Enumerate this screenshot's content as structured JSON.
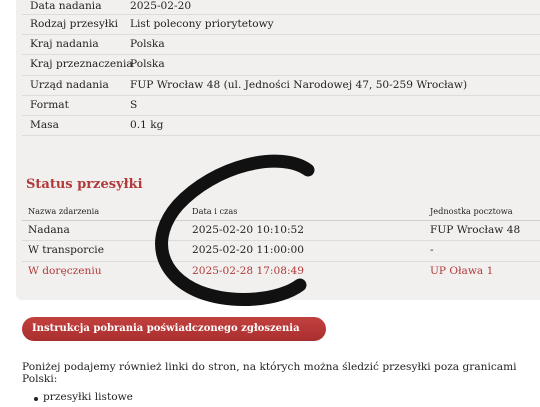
{
  "details": [
    {
      "label": "Data nadania",
      "value": "2025-02-20"
    },
    {
      "label": "Rodzaj przesyłki",
      "value": "List polecony priorytetowy"
    },
    {
      "label": "Kraj nadania",
      "value": "Polska"
    },
    {
      "label": "Kraj przeznaczenia",
      "value": "Polska"
    },
    {
      "label": "Urząd nadania",
      "value": "FUP Wrocław 48 (ul. Jedności Narodowej 47, 50-259 Wrocław)"
    },
    {
      "label": "Format",
      "value": "S"
    },
    {
      "label": "Masa",
      "value": "0.1 kg"
    }
  ],
  "status": {
    "title": "Status przesyłki",
    "headers": [
      "Nazwa zdarzenia",
      "Data i czas",
      "Jednostka pocztowa"
    ],
    "rows": [
      {
        "event": "Nadana",
        "datetime": "2025-02-20 10:10:52",
        "unit": "FUP Wrocław 48"
      },
      {
        "event": "W transporcie",
        "datetime": "2025-02-20 11:00:00",
        "unit": "-"
      },
      {
        "event": "W doręczeniu",
        "datetime": "2025-02-28 17:08:49",
        "unit": "UP Oława 1"
      }
    ]
  },
  "customs_button": "Instrukcja pobrania poświadczonego zgłoszenia celnego",
  "info_text": "Poniżej podajemy również linki do stron, na których można śledzić przesyłki poza granicami Polski:",
  "links": [
    "przesyłki listowe"
  ],
  "colors": {
    "accent": "#b03a3a",
    "panel": "#f2f0ef"
  }
}
